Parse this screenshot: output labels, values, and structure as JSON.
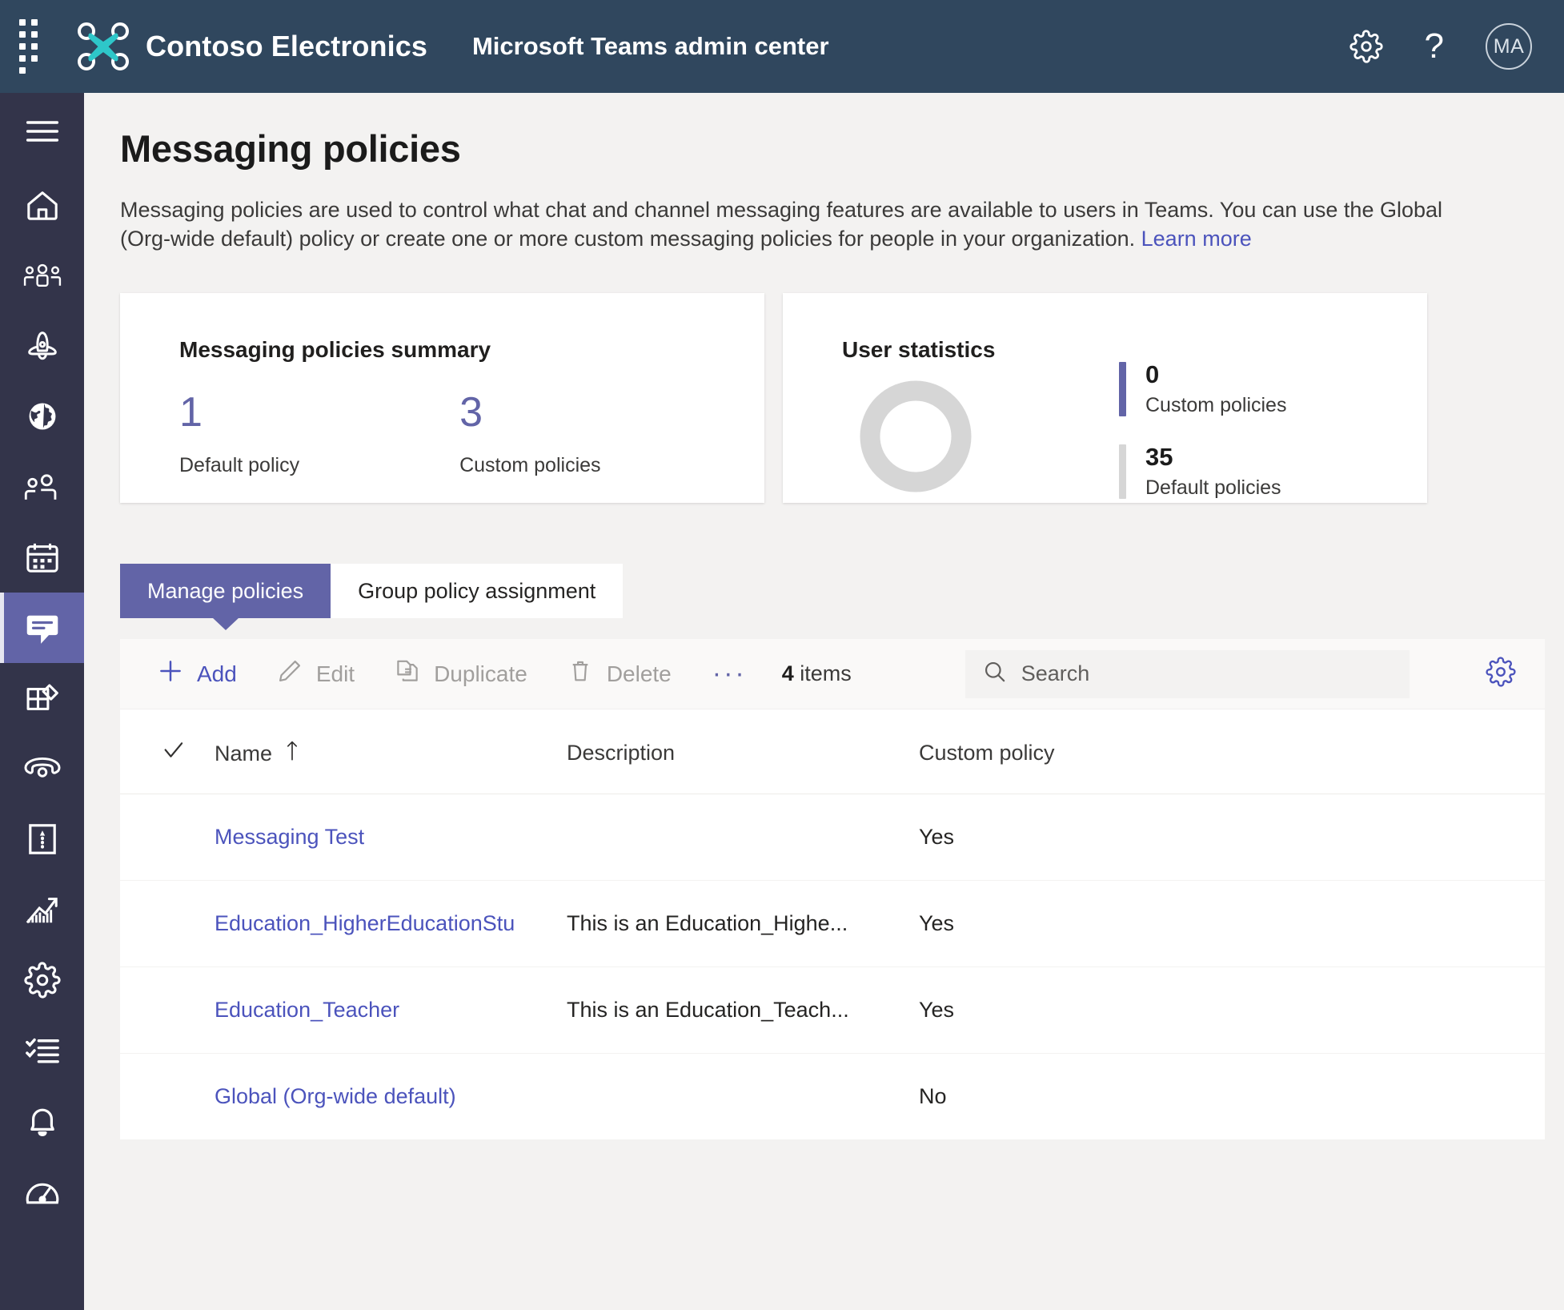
{
  "topbar": {
    "waffle_label": "app-launcher",
    "org_name": "Contoso Electronics",
    "app_title": "Microsoft Teams admin center",
    "settings_label": "Settings",
    "help_label": "?",
    "avatar_initials": "MA"
  },
  "rail": {
    "items": [
      {
        "icon": "hamburger-icon",
        "label": "Menu"
      },
      {
        "icon": "home-icon",
        "label": "Dashboard"
      },
      {
        "icon": "teams-icon",
        "label": "Teams"
      },
      {
        "icon": "devices-icon",
        "label": "Devices"
      },
      {
        "icon": "globe-icon",
        "label": "Locations"
      },
      {
        "icon": "users-icon",
        "label": "Users"
      },
      {
        "icon": "calendar-icon",
        "label": "Meetings"
      },
      {
        "icon": "messaging-icon",
        "label": "Messaging policies"
      },
      {
        "icon": "apps-icon",
        "label": "Teams apps"
      },
      {
        "icon": "voice-icon",
        "label": "Voice"
      },
      {
        "icon": "policy-package-icon",
        "label": "Policy packages"
      },
      {
        "icon": "analytics-icon",
        "label": "Analytics & reports"
      },
      {
        "icon": "gear-icon",
        "label": "Org-wide settings"
      },
      {
        "icon": "planning-icon",
        "label": "Planning"
      },
      {
        "icon": "bell-icon",
        "label": "Notifications & alerts"
      },
      {
        "icon": "gauge-icon",
        "label": "Call quality dashboard"
      }
    ]
  },
  "page": {
    "title": "Messaging policies",
    "description": "Messaging policies are used to control what chat and channel messaging features are available to users in Teams. You can use the Global (Org-wide default) policy or create one or more custom messaging policies for people in your organization.",
    "learn_more": "Learn more"
  },
  "summary_card": {
    "title": "Messaging policies summary",
    "stats": [
      {
        "value": "1",
        "label": "Default policy"
      },
      {
        "value": "3",
        "label": "Custom policies"
      }
    ]
  },
  "user_statistics_card": {
    "title": "User statistics",
    "legend": [
      {
        "value": "0",
        "label": "Custom policies",
        "color": "#6264a7"
      },
      {
        "value": "35",
        "label": "Default policies",
        "color": "#d6d6d6"
      }
    ]
  },
  "chart_data": {
    "type": "pie",
    "title": "User statistics",
    "categories": [
      "Custom policies",
      "Default policies"
    ],
    "values": [
      0,
      35
    ],
    "colors": [
      "#6264a7",
      "#d6d6d6"
    ],
    "legend_position": "right",
    "donut": true
  },
  "tabs": [
    {
      "label": "Manage policies",
      "active": true
    },
    {
      "label": "Group policy assignment",
      "active": false
    }
  ],
  "toolbar": {
    "add_label": "Add",
    "edit_label": "Edit",
    "duplicate_label": "Duplicate",
    "delete_label": "Delete",
    "overflow_label": "···",
    "item_count_number": "4",
    "item_count_suffix": " items",
    "search_placeholder": "Search",
    "search_value": "",
    "settings_label": "Column settings"
  },
  "table": {
    "columns": [
      "Name",
      "Description",
      "Custom policy"
    ],
    "sort_column": "Name",
    "sort_direction": "ascending",
    "rows": [
      {
        "name": "Messaging Test",
        "description": "",
        "custom_policy": "Yes"
      },
      {
        "name": "Education_HigherEducationStu",
        "description": "This is an Education_Highe...",
        "custom_policy": "Yes"
      },
      {
        "name": "Education_Teacher",
        "description": "This is an Education_Teach...",
        "custom_policy": "Yes"
      },
      {
        "name": "Global (Org-wide default)",
        "description": "",
        "custom_policy": "No"
      }
    ]
  }
}
